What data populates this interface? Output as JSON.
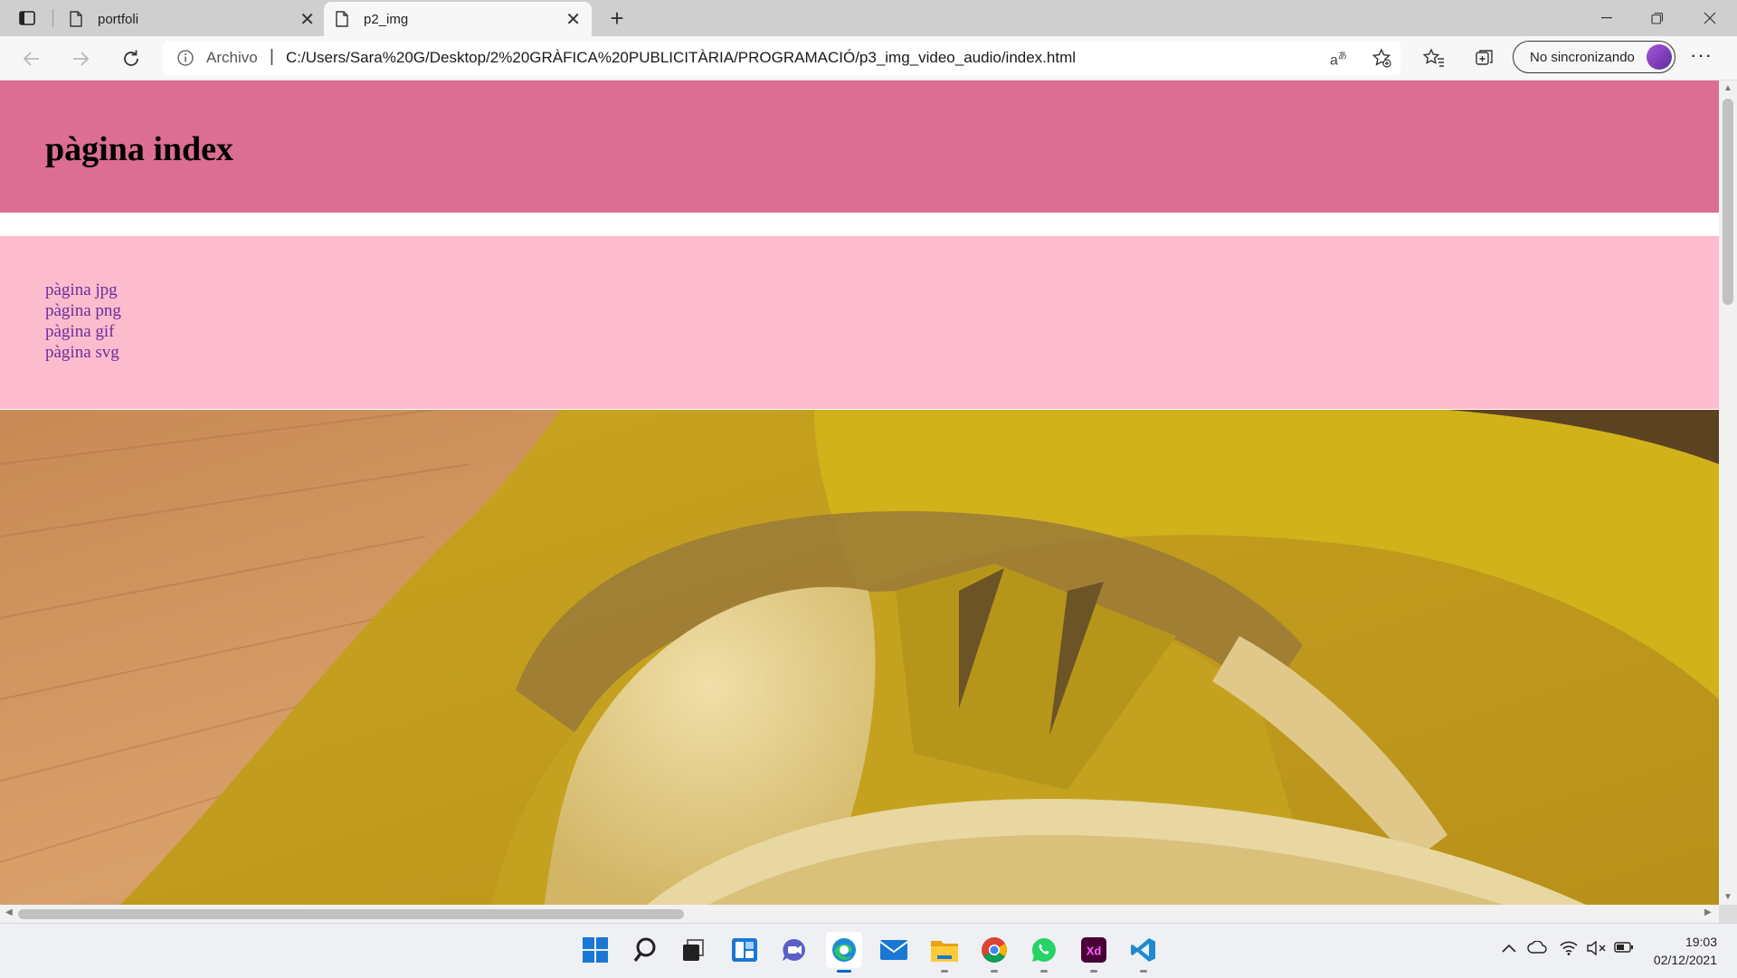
{
  "browser": {
    "tabs": [
      {
        "title": "portfoli",
        "active": false
      },
      {
        "title": "p2_img",
        "active": true
      }
    ],
    "address": {
      "scheme_label": "Archivo",
      "url": "C:/Users/Sara%20G/Desktop/2%20GRÀFICA%20PUBLICITÀRIA/PROGRAMACIÓ/p3_img_video_audio/index.html"
    },
    "profile_label": "No sincronizando"
  },
  "page": {
    "title": "pàgina index",
    "header_color": "#db6e92",
    "nav_bg_color": "#fcbccd",
    "link_color": "#6d2d9c",
    "links": [
      "pàgina jpg",
      "pàgina png",
      "pàgina gif",
      "pàgina svg"
    ]
  },
  "taskbar": {
    "apps": [
      "start-icon",
      "search-icon",
      "task-view-icon",
      "widgets-icon",
      "teams-chat-icon",
      "edge-icon",
      "mail-icon",
      "file-explorer-icon",
      "chrome-icon",
      "whatsapp-icon",
      "adobe-xd-icon",
      "vscode-icon"
    ],
    "time": "19:03",
    "date": "02/12/2021"
  }
}
